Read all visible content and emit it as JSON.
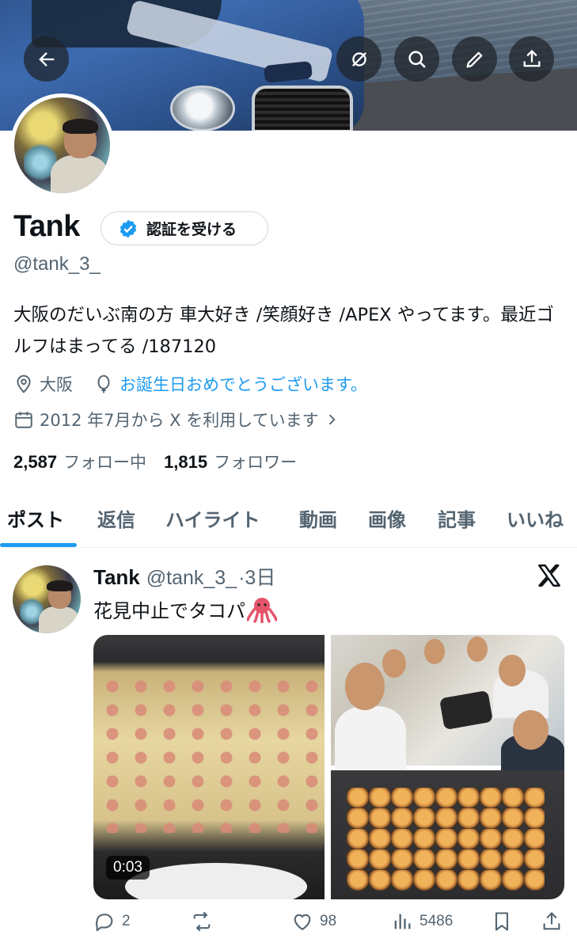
{
  "header": {
    "back_icon": "arrow-left-icon",
    "actions": [
      "grok-icon",
      "search-icon",
      "pencil-icon",
      "share-icon"
    ]
  },
  "profile": {
    "name": "Tank",
    "verify_label": "認証を受ける",
    "handle": "@tank_3_",
    "bio": "大阪のだいぶ南の方 車大好き /笑顔好き /APEX やってます。最近ゴルフはまってる /187120",
    "location": "大阪",
    "birthday": "お誕生日おめでとうございます。",
    "joined": "2012 年7月から X を利用しています",
    "following_count": "2,587",
    "following_label": "フォロー中",
    "followers_count": "1,815",
    "followers_label": "フォロワー",
    "accent_color": "#1d9bf0"
  },
  "tabs": [
    "ポスト",
    "返信",
    "ハイライト",
    "動画",
    "画像",
    "記事",
    "いいね"
  ],
  "post": {
    "name": "Tank",
    "handle": "@tank_3_",
    "time": "·3日",
    "text": "花見中止でタコパ",
    "video_duration": "0:03",
    "replies": "2",
    "likes": "98",
    "views": "5486"
  }
}
